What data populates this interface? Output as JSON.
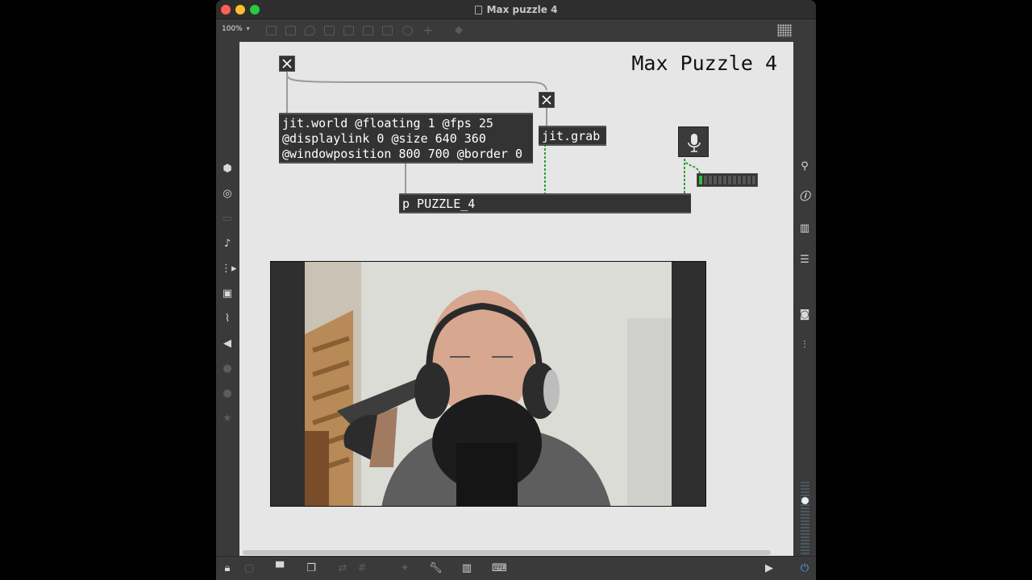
{
  "window": {
    "title": "Max puzzle 4"
  },
  "toolbar": {
    "zoom": "100%",
    "zoom_caret": "▾"
  },
  "patch": {
    "title": "Max Puzzle 4",
    "objects": {
      "jit_world": "jit.world @floating 1 @fps 25\n@displaylink 0 @size 640 360\n@windowposition 800 700 @border 0",
      "jit_grab": "jit.grab",
      "p_puzzle": "p PUZZLE_4"
    }
  },
  "colors": {
    "canvas": "#e6e6e6",
    "object_bg": "#333333",
    "signal_patchcord": "#2e9f2e",
    "meter_green": "#2fbf3f"
  },
  "icons": {
    "left_sidebar": [
      "package-icon",
      "target-icon",
      "panel-icon",
      "music-note-icon",
      "sequence-icon",
      "image-icon",
      "paperclip-icon",
      "plug-icon",
      "vizzie-icon",
      "beap-icon",
      "star-icon"
    ],
    "right_sidebar": [
      "search-icon",
      "info-icon",
      "book-icon",
      "list-icon",
      "camera-icon",
      "mixer-icon"
    ],
    "bottom_bar": [
      "lock-icon",
      "presentation-icon",
      "comment-icon",
      "layers-icon",
      "sync-icon",
      "grid-icon",
      "snap-icon",
      "wrench-icon",
      "piano-icon",
      "keyboard-icon",
      "play-icon",
      "power-icon"
    ]
  }
}
